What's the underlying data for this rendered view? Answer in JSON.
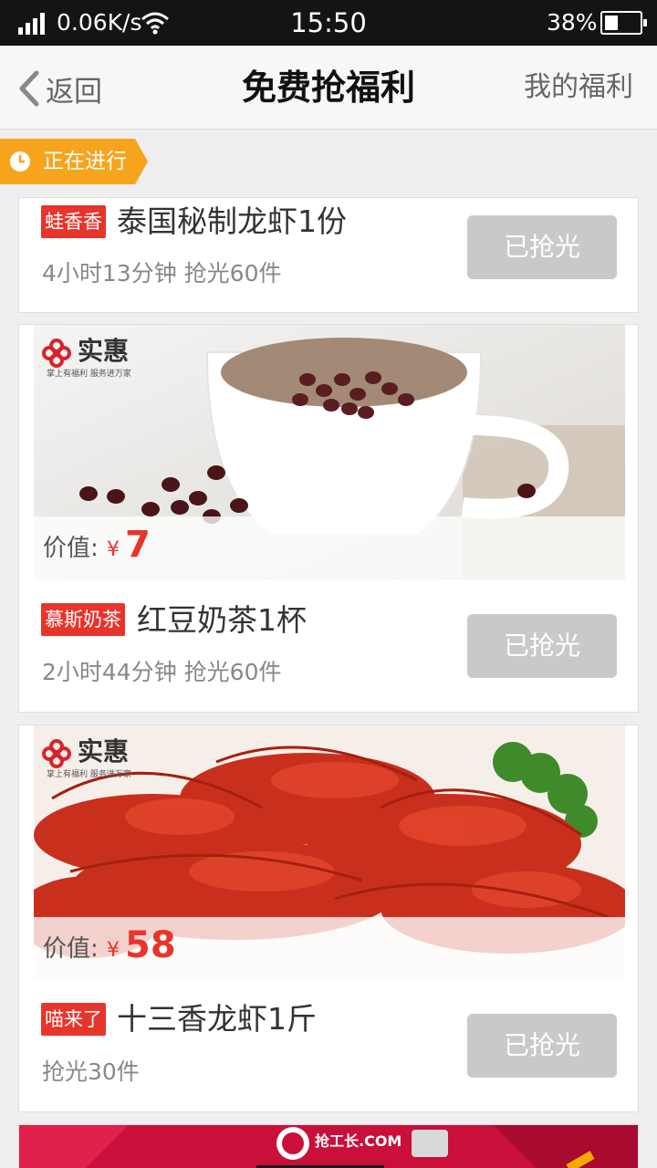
{
  "status_bar": {
    "speed": "0.06K/s",
    "time": "15:50",
    "battery": "38%",
    "battery_level": 0.38
  },
  "header": {
    "back_label": "返回",
    "title": "免费抢福利",
    "right_link": "我的福利"
  },
  "section": {
    "label": "正在进行"
  },
  "items": [
    {
      "shop": "蛙香香",
      "name": "泰国秘制龙虾1份",
      "meta": "4小时13分钟 抢光60件",
      "button": "已抢光"
    },
    {
      "brand": "实惠",
      "brand_sub": "掌上有福利  服务进万家",
      "price_label": "价值:",
      "currency": "¥",
      "price": "7",
      "shop": "慕斯奶茶",
      "name": "红豆奶茶1杯",
      "meta": "2小时44分钟 抢光60件",
      "button": "已抢光"
    },
    {
      "brand": "实惠",
      "brand_sub": "掌上有福利  服务进万家",
      "price_label": "价值:",
      "currency": "¥",
      "price": "58",
      "shop": "喵来了",
      "name": "十三香龙虾1斤",
      "meta": "抢光30件",
      "button": "已抢光"
    }
  ],
  "banner": {
    "logo": "抢工长.COM"
  },
  "colors": {
    "accent_red": "#e8352c",
    "tag_orange": "#f7a41d",
    "disabled_button": "#c9c9c9"
  }
}
